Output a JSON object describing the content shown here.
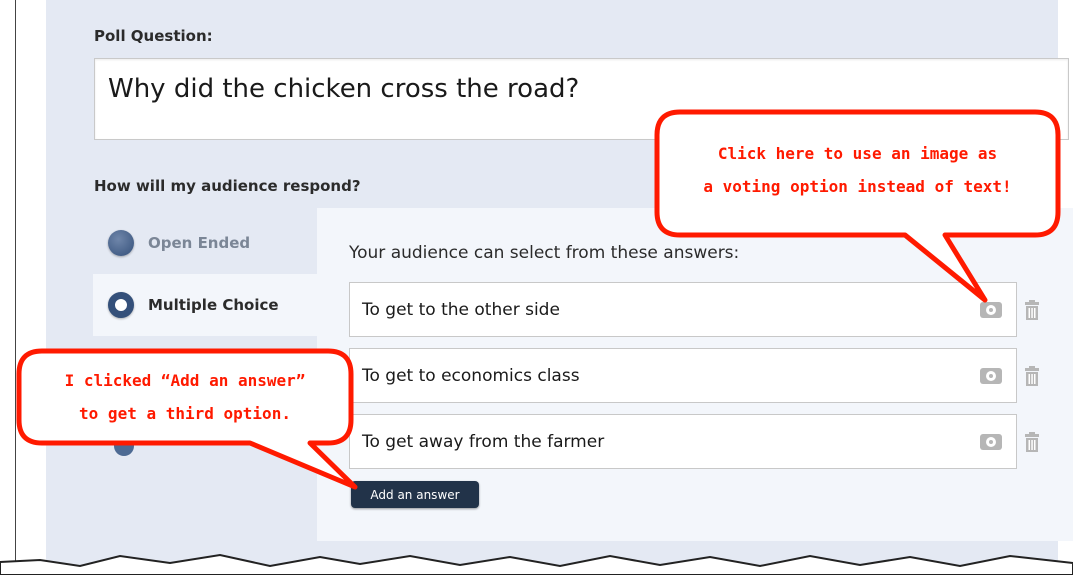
{
  "poll": {
    "question_label": "Poll Question:",
    "question_text": "Why did the chicken cross the road?",
    "respond_label": "How will my audience respond?"
  },
  "modes": [
    {
      "label": "Open Ended",
      "selected": false
    },
    {
      "label": "Multiple Choice",
      "selected": true
    }
  ],
  "answers": {
    "caption": "Your audience can select from these answers:",
    "items": [
      {
        "text": "To get to the other side",
        "icon": "camera-icon",
        "delete_icon": "trash-icon"
      },
      {
        "text": "To get to economics class",
        "icon": "camera-icon",
        "delete_icon": "trash-icon"
      },
      {
        "text": "To get away from the farmer",
        "icon": "camera-icon",
        "delete_icon": "trash-icon"
      }
    ],
    "add_button": "Add an answer"
  },
  "callouts": {
    "image_tip_line1": "Click here to use an image as",
    "image_tip_line2": "a voting option instead of text!",
    "add_tip_line1": "I clicked “Add an answer”",
    "add_tip_line2": "to get a third option."
  },
  "colors": {
    "panel_bg": "#e4e9f3",
    "button_bg": "#223349",
    "radio": "#34507a",
    "callout_stroke": "#ff1a00"
  }
}
